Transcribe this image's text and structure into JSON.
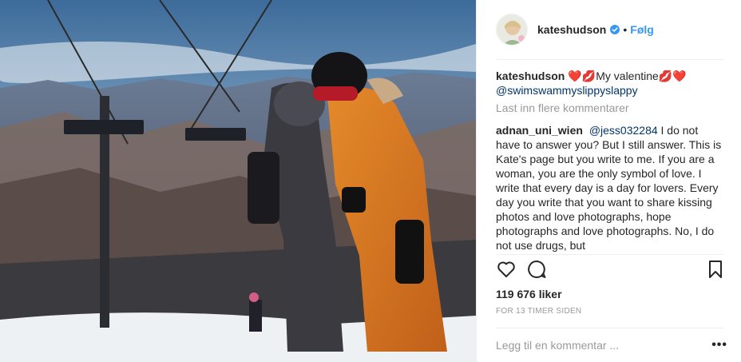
{
  "post": {
    "username": "kateshudson",
    "follow_label": "Følg",
    "separator": "•",
    "caption_text": "My valentine",
    "caption_heart_before": "❤️💋",
    "caption_heart_after": "💋❤️",
    "caption_mention": "@swimswammyslippyslappy",
    "load_more": "Last inn flere kommentarer",
    "comment": {
      "username": "adnan_uni_wien",
      "mention": "@jess032284",
      "text": "I do not have to answer you? But I still answer. This is Kate's page but you write to me. If you are a woman, you are the only symbol of love. I write that every day is a day for lovers. Every day you write that you want to share kissing photos and love photographs, hope photographs and love photographs. No, I do not use drugs, but"
    },
    "likes": "119 676 liker",
    "timestamp": "FOR 13 TIMER SIDEN",
    "comment_placeholder": "Legg til en kommentar ...",
    "more_label": "•••"
  },
  "colors": {
    "link": "#3897f0",
    "mention": "#003569",
    "muted": "#999999",
    "text": "#262626"
  },
  "icons": {
    "heart": "heart-icon",
    "comment": "comment-icon",
    "bookmark": "bookmark-icon",
    "verified": "verified-badge-icon"
  }
}
